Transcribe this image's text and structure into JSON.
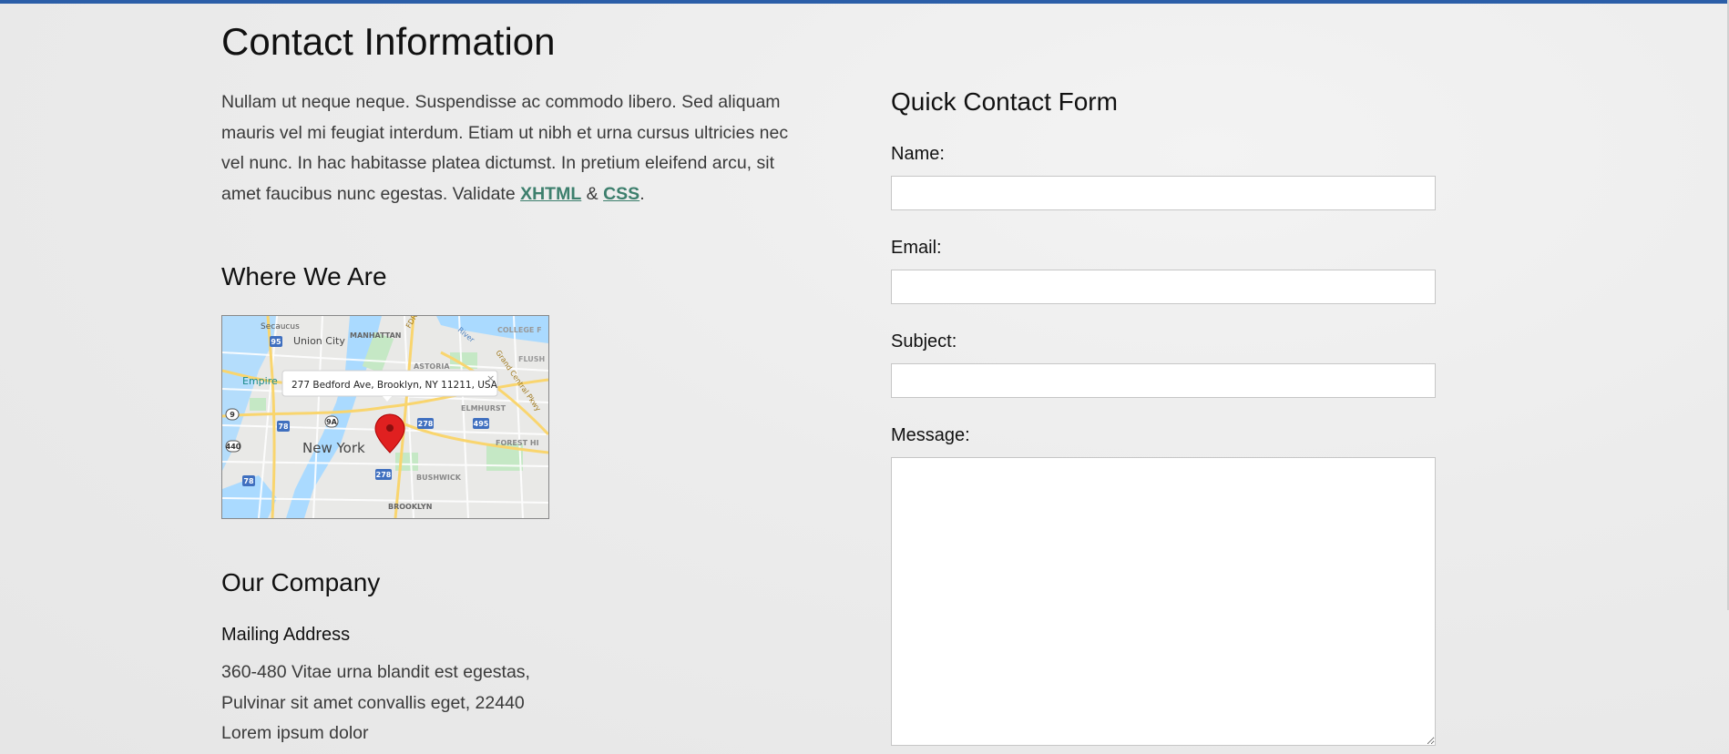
{
  "page": {
    "title": "Contact Information"
  },
  "intro": {
    "text": "Nullam ut neque neque. Suspendisse ac commodo libero. Sed aliquam mauris vel mi feugiat interdum. Etiam ut nibh et urna cursus ultricies nec vel nunc. In hac habitasse platea dictumst. In pretium eleifend arcu, sit amet faucibus nunc egestas. Validate ",
    "link_xhtml": "XHTML",
    "amp": " & ",
    "link_css": "CSS",
    "end": "."
  },
  "where": {
    "heading": "Where We Are",
    "map": {
      "popup_address": "277 Bedford Ave, Brooklyn, NY 11211, USA",
      "close": "×",
      "labels": {
        "secaucus": "Secaucus",
        "union_city": "Union City",
        "manhattan": "MANHATTAN",
        "astoria": "ASTORIA",
        "empire": "Empire",
        "new_york": "New York",
        "elmhurst": "ELMHURST",
        "forest_hills": "FOREST HI",
        "bushwick": "BUSHWICK",
        "brooklyn": "BROOKLYN",
        "college": "COLLEGE F",
        "flush": "FLUSH",
        "grand_central": "Grand Central Pkwy",
        "fdr": "FDR",
        "river": "River"
      },
      "shields": [
        "95",
        "9A",
        "78",
        "278",
        "495",
        "440",
        "9",
        "278",
        "78"
      ]
    }
  },
  "company": {
    "heading": "Our Company",
    "mailing_heading": "Mailing Address",
    "address_lines": [
      "360-480 Vitae urna blandit est egestas,",
      "Pulvinar sit amet convallis eget, 22440",
      "Lorem ipsum dolor"
    ]
  },
  "form": {
    "heading": "Quick Contact Form",
    "name_label": "Name:",
    "name_value": "",
    "email_label": "Email:",
    "email_value": "",
    "subject_label": "Subject:",
    "subject_value": "",
    "message_label": "Message:",
    "message_value": ""
  },
  "colors": {
    "accent_bar": "#2b5ea8",
    "link": "#3d7f6d",
    "map_pin": "#e02020"
  }
}
